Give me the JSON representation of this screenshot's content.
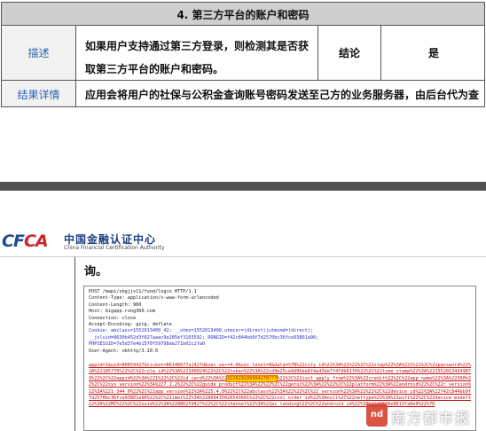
{
  "report": {
    "title": "4.  第三方平台的账户和密码",
    "desc_label": "描述",
    "desc_text": "如果用户支持通过第三方登录，则检测其是否获取第三方平台的账户和密码。",
    "conclusion_label": "结论",
    "conclusion_value": "是",
    "detail_label": "结果详情",
    "detail_text": "应用会将用户的社保与公积金查询账号密码发送至己方的业务服务器，由后台代为查"
  },
  "page2": {
    "logo_mark_a": "CF",
    "logo_mark_b": "CA",
    "logo_cn": "中国金融认证中心",
    "logo_en": "China Financial Certification Authority",
    "continued_text": "询。"
  },
  "capture": {
    "request_line": "POST /mapi/sbgjjv11/fund/login HTTP/1.1",
    "content_type": "Content-Type: application/x-www-form-urlencoded",
    "content_length": "Content-Length: 960",
    "host": "Host: bigapp.rong360.com",
    "connection": "Connection: close",
    "accept_encoding": "Accept-Encoding: gzip, deflate",
    "cookie_1": "Cookie: abclass=1552013400_42; __utmz=1552013400.utmcsr=(direct)|utmcmd=(direct);",
    "cookie_2": "__jsluid=8630b452d3f827aaac9e285ef3103592; RONGID=f42c844bb9f7d2570bc36fce93801a96;",
    "cookie_3": "PHPSESSID=7e5d37e4b1570f59798de271b02c2fa0",
    "user_agent": "User-Agent: okhttp/3.10.0",
    "params_1": "appid=1&uid=80659427&ticket=86146677a1427d&sec_ver=4.0&sec_level=0&data=%7B%22city_id%22%3A%22%22%2C%22step%22%3A%221%22%2C%22password%22%3A%22185776%22%2C%22rule_id%22%3A%22100024%22%2C%22token%22%3A%22cd9e25ce9d9bbe8f4a43de7f4f9b61f0%22%2C%22time_stamp%22%3A%2215520134349879%22%2C%22appid%22%3A%221%22%2C%22id_card%22%3A%22",
    "params_hl": "322629199304270???",
    "params_2": "%22%2C%22isol_apply_from%22%3A%22credit%22%2C%22app_name%22%3A%22360%22%2C%22sys_version%22%3A%227.1.2%22%2C%22guide_product%22%3A%22%22%2C%22getui%22%3A%22%22%2C%22platform%22%3A%22android%22%2C%22r_version%22%3A%221_344_0%22%2C%22app_version%22%3A%225.4.0%22%2C%22abclass%22%3A%22%22%2C%22_version%22%3A%22%22%2C%22device_id%22%3A%22f42c844bb9f7d2570bc36fce93801a96%22%2C%22imei%22%3A%22869435026543601%22%2C%22isol_order_id%22%3Anull%2C%22nettype%22%3A%22wifi%22%2C%22device_model%22%3A%22MI%22%2C%22uuid%22%3A%22886259427%22%2C%22channel%22%3A%22pc_landing%22%2C%22android_id%22%3A%22d9606e8613fa0e9%22%7D"
  },
  "watermark": {
    "badge": "nd",
    "text": "南方都市报"
  },
  "colors": {
    "label_blue": "#2e61b5",
    "header_gray": "#cfcfcf",
    "param_red": "#c01010",
    "highlight": "#ffd400",
    "logo_blue": "#1e4a98",
    "logo_red": "#c8262d"
  }
}
